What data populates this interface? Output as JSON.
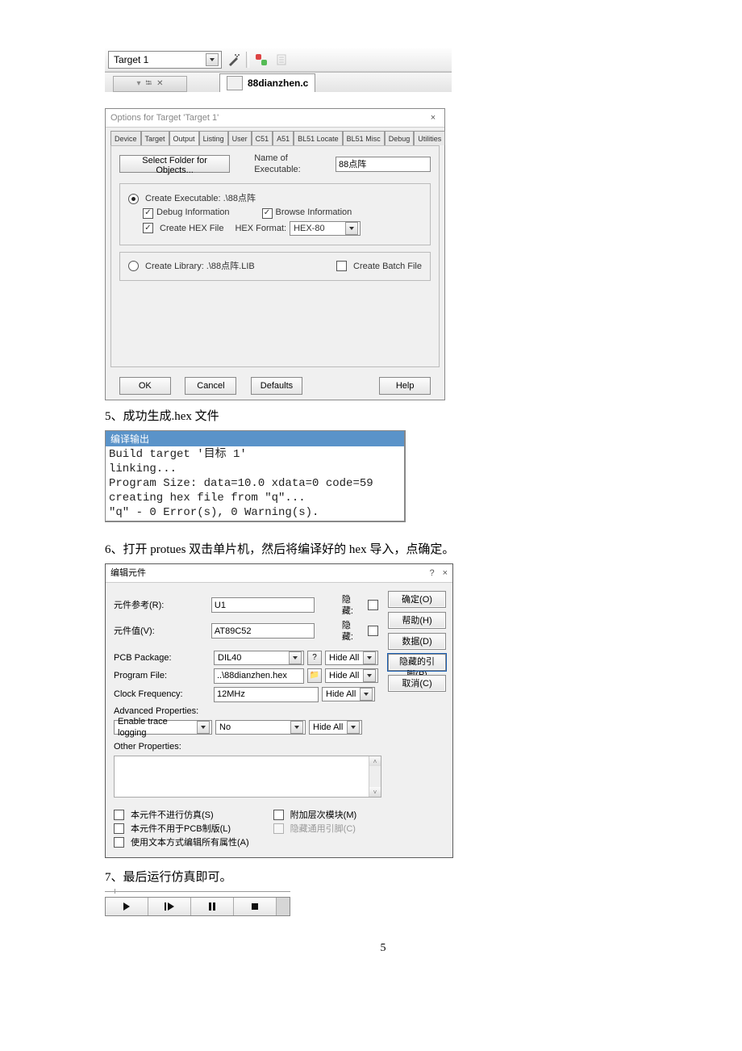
{
  "toolbar_top": {
    "target_combo": "Target 1",
    "file_tab": "88dianzhen.c"
  },
  "dlg1": {
    "title": "Options for Target 'Target 1'",
    "tabs": [
      "Device",
      "Target",
      "Output",
      "Listing",
      "User",
      "C51",
      "A51",
      "BL51 Locate",
      "BL51 Misc",
      "Debug",
      "Utilities"
    ],
    "active_tab": "Output",
    "select_folder_btn": "Select Folder for Objects...",
    "name_exec_label": "Name of Executable:",
    "name_exec_value": "88点阵",
    "create_exec_label": "Create Executable:  .\\88点阵",
    "debug_info": "Debug Information",
    "browse_info": "Browse Information",
    "create_hex": "Create HEX File",
    "hex_format_label": "HEX Format:",
    "hex_format_value": "HEX-80",
    "create_lib_label": "Create Library:  .\\88点阵.LIB",
    "create_batch": "Create Batch File",
    "btns": {
      "ok": "OK",
      "cancel": "Cancel",
      "defaults": "Defaults",
      "help": "Help"
    }
  },
  "step5": "5、成功生成.hex 文件",
  "console": {
    "header": "编译输出",
    "lines": [
      "Build target '目标 1'",
      "linking...",
      "Program Size: data=10.0 xdata=0 code=59",
      "creating hex file from \"q\"...",
      "\"q\" - 0 Error(s), 0 Warning(s)."
    ]
  },
  "step6": "6、打开 protues 双击单片机，然后将编译好的 hex 导入，点确定。",
  "dlg2": {
    "title": "编辑元件",
    "labels": {
      "ref": "元件参考(R):",
      "val": "元件值(V):",
      "pcb": "PCB Package:",
      "prog": "Program File:",
      "clock": "Clock Frequency:",
      "adv": "Advanced Properties:",
      "trace": "Enable trace logging",
      "other": "Other Properties:"
    },
    "values": {
      "ref": "U1",
      "val": "AT89C52",
      "pcb": "DIL40",
      "prog": "..\\88dianzhen.hex",
      "clock": "12MHz",
      "trace": "No"
    },
    "hide": "隐藏:",
    "hide_all": "Hide All",
    "checks": {
      "c1": "本元件不进行仿真(S)",
      "c2": "本元件不用于PCB制版(L)",
      "c3": "使用文本方式编辑所有属性(A)",
      "c4": "附加层次模块(M)",
      "c5": "隐藏通用引脚(C)"
    },
    "btns": {
      "ok": "确定(O)",
      "help": "帮助(H)",
      "data": "数据(D)",
      "pins": "隐藏的引脚(P)",
      "cancel": "取消(C)"
    }
  },
  "step7": "7、最后运行仿真即可。",
  "page_num": "5"
}
